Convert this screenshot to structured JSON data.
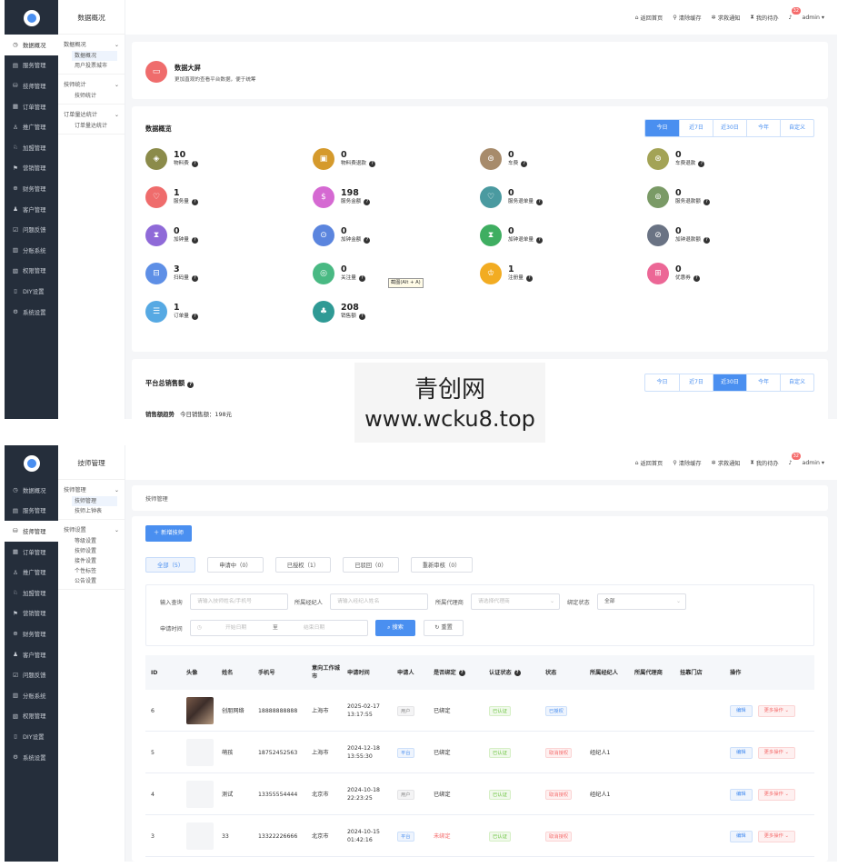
{
  "menu": [
    {
      "icon": "◷",
      "label": "数据概况"
    },
    {
      "icon": "▤",
      "label": "服务管理"
    },
    {
      "icon": "⛁",
      "label": "技师管理"
    },
    {
      "icon": "▦",
      "label": "订单管理"
    },
    {
      "icon": "♙",
      "label": "推广管理"
    },
    {
      "icon": "♘",
      "label": "加盟管理"
    },
    {
      "icon": "⚑",
      "label": "营销管理"
    },
    {
      "icon": "⊕",
      "label": "财务管理"
    },
    {
      "icon": "♟",
      "label": "客户管理"
    },
    {
      "icon": "☑",
      "label": "问题反馈"
    },
    {
      "icon": "▥",
      "label": "分账系统"
    },
    {
      "icon": "▧",
      "label": "权限管理"
    },
    {
      "icon": "▯",
      "label": "DIY设置"
    },
    {
      "icon": "⚙",
      "label": "系统设置"
    }
  ],
  "topbar": {
    "home": "返回首页",
    "cache": "清除缓存",
    "help": "求救通知",
    "todo": "我的待办",
    "badge": "32",
    "user": "admin ▾"
  },
  "screen1": {
    "sub_title": "数据概况",
    "sub_groups": [
      {
        "title": "数据概况",
        "items": [
          "数据概况",
          "用户投票城市"
        ]
      },
      {
        "title": "技师统计",
        "items": [
          "技师统计"
        ]
      },
      {
        "title": "订单量达统计",
        "items": [
          "订单量达统计"
        ]
      }
    ],
    "banner": {
      "title": "数据大屏",
      "desc": "更加直观的查看平台数据，便于统筹"
    },
    "overview_title": "数据概览",
    "filters": [
      "今日",
      "近7日",
      "近30日",
      "今年",
      "自定义"
    ],
    "stats": [
      {
        "value": "10",
        "label": "物料费",
        "color": "#8b8b4a",
        "icon": "◈"
      },
      {
        "value": "0",
        "label": "物料费退款",
        "color": "#d59a2c",
        "icon": "▣"
      },
      {
        "value": "0",
        "label": "车费",
        "color": "#a78b6b",
        "icon": "⊜"
      },
      {
        "value": "0",
        "label": "车费退款",
        "color": "#a3a356",
        "icon": "⊛"
      },
      {
        "value": "1",
        "label": "服务量",
        "color": "#ef6c6c",
        "icon": "♡"
      },
      {
        "value": "198",
        "label": "服务金额",
        "color": "#d569d2",
        "icon": "$"
      },
      {
        "value": "0",
        "label": "服务退单量",
        "color": "#4a9aa0",
        "icon": "♡"
      },
      {
        "value": "0",
        "label": "服务退款额",
        "color": "#7a9a66",
        "icon": "⊚"
      },
      {
        "value": "0",
        "label": "加钟量",
        "color": "#8f6ad8",
        "icon": "⧗"
      },
      {
        "value": "0",
        "label": "加钟金额",
        "color": "#5b85de",
        "icon": "⊙"
      },
      {
        "value": "0",
        "label": "加钟退单量",
        "color": "#3fae61",
        "icon": "⧗"
      },
      {
        "value": "0",
        "label": "加钟退款额",
        "color": "#6a7384",
        "icon": "⊘"
      },
      {
        "value": "3",
        "label": "扫码量",
        "color": "#5e8fe6",
        "icon": "⊟"
      },
      {
        "value": "0",
        "label": "关注量",
        "color": "#49b983",
        "icon": "◎"
      },
      {
        "value": "1",
        "label": "注册量",
        "color": "#f2ac22",
        "icon": "♔"
      },
      {
        "value": "0",
        "label": "优惠券",
        "color": "#ec6796",
        "icon": "⊞"
      },
      {
        "value": "1",
        "label": "订单量",
        "color": "#56a9e3",
        "icon": "☰"
      },
      {
        "value": "208",
        "label": "销售额",
        "color": "#2f9a95",
        "icon": "♣"
      }
    ],
    "tooltip": "截图(Alt + A)",
    "sales_title": "平台总销售额",
    "sales_filters": [
      "今日",
      "近7日",
      "近30日",
      "今年",
      "自定义"
    ],
    "sales_trend_label": "销售额趋势",
    "sales_today": "今日销售额：198元"
  },
  "screen2": {
    "sub_title": "技师管理",
    "sub_groups": [
      {
        "title": "技师管理",
        "items": [
          "技师管理",
          "技师上钟表"
        ]
      },
      {
        "title": "技师设置",
        "items": [
          "等级设置",
          "技师设置",
          "接件设置",
          "个性标签",
          "公告设置"
        ]
      }
    ],
    "breadcrumb": "技师管理",
    "add_button": "＋ 新增技师",
    "tabs": [
      "全部（5）",
      "申请中（0）",
      "已授权（1）",
      "已驳回（0）",
      "重新审核（0）"
    ],
    "filter": {
      "input_label": "输入查询",
      "input_ph": "请输入技师姓名/手机号",
      "agent_label": "所属经纪人",
      "agent_ph": "请输入经纪人姓名",
      "proxy_label": "所属代理商",
      "proxy_ph": "请选择代理商",
      "bind_label": "绑定状态",
      "bind_value": "全部",
      "time_label": "申请时间",
      "start_ph": "开始日期",
      "to": "至",
      "end_ph": "结束日期",
      "search": "⌕ 搜索",
      "reset": "↻ 重置"
    },
    "columns": [
      "ID",
      "头像",
      "姓名",
      "手机号",
      "意向工作城市",
      "申请时间",
      "申请人",
      "是否绑定",
      "认证状态",
      "状态",
      "所属经纪人",
      "所属代理商",
      "挂靠门店",
      "操作"
    ],
    "rows": [
      {
        "id": "6",
        "name": "创朋网络",
        "phone": "18888888888",
        "city": "上海市",
        "time": "2025-02-17 13:17:55",
        "applicant": "用户",
        "bind": "已绑定",
        "cert": "已认证",
        "status": "已授权",
        "agent": "",
        "has_avatar": true
      },
      {
        "id": "5",
        "name": "萌孩",
        "phone": "18752452563",
        "city": "上海市",
        "time": "2024-12-18 13:55:30",
        "applicant": "平台",
        "bind": "已绑定",
        "cert": "已认证",
        "status": "取消授权",
        "agent": "经纪人1",
        "has_avatar": false
      },
      {
        "id": "4",
        "name": "测试",
        "phone": "13355554444",
        "city": "北京市",
        "time": "2024-10-18 22:23:25",
        "applicant": "用户",
        "bind": "已绑定",
        "cert": "已认证",
        "status": "取消授权",
        "agent": "经纪人1",
        "has_avatar": false
      },
      {
        "id": "3",
        "name": "33",
        "phone": "13322226666",
        "city": "北京市",
        "time": "2024-10-15 01:42:16",
        "applicant": "平台",
        "bind": "未绑定",
        "cert": "已认证",
        "status": "取消授权",
        "agent": "",
        "has_avatar": false
      }
    ],
    "op_edit": "编辑",
    "op_more": "更多操作 ⌄"
  },
  "watermark": {
    "line1": "青创网",
    "line2": "www.wcku8.top"
  }
}
